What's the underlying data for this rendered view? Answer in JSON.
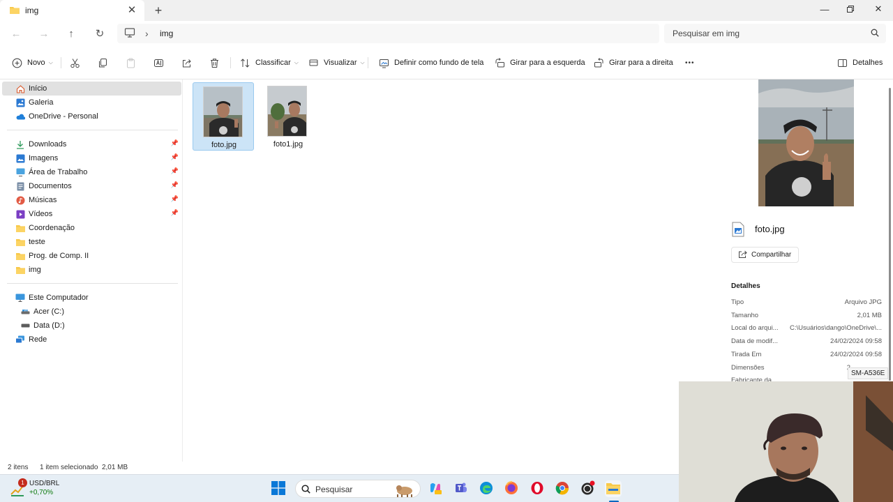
{
  "window": {
    "tab_title": "img",
    "new_tab_symbol": "+"
  },
  "address": {
    "crumb": "img",
    "search_placeholder": "Pesquisar em img"
  },
  "toolbar": {
    "new_label": "Novo",
    "sort_label": "Classificar",
    "view_label": "Visualizar",
    "wallpaper_label": "Definir como fundo de tela",
    "rotate_left_label": "Girar para a esquerda",
    "rotate_right_label": "Girar para a direita",
    "more_symbol": "•••",
    "details_label": "Detalhes"
  },
  "sidebar": {
    "top": [
      {
        "label": "Início",
        "icon": "home-icon"
      },
      {
        "label": "Galeria",
        "icon": "gallery-icon"
      },
      {
        "label": "OneDrive - Personal",
        "icon": "onedrive-icon"
      }
    ],
    "quick": [
      {
        "label": "Downloads",
        "icon": "download-icon"
      },
      {
        "label": "Imagens",
        "icon": "pictures-icon"
      },
      {
        "label": "Área de Trabalho",
        "icon": "desktop-icon"
      },
      {
        "label": "Documentos",
        "icon": "documents-icon"
      },
      {
        "label": "Músicas",
        "icon": "music-icon"
      },
      {
        "label": "Vídeos",
        "icon": "videos-icon"
      },
      {
        "label": "Coordenação",
        "icon": "folder-icon"
      },
      {
        "label": "teste",
        "icon": "folder-icon"
      },
      {
        "label": "Prog. de Comp. II",
        "icon": "folder-icon"
      },
      {
        "label": "img",
        "icon": "folder-icon"
      }
    ],
    "devices": [
      {
        "label": "Este Computador",
        "icon": "computer-icon"
      },
      {
        "label": "Acer (C:)",
        "icon": "drive-icon"
      },
      {
        "label": "Data (D:)",
        "icon": "drive-icon"
      },
      {
        "label": "Rede",
        "icon": "network-icon"
      }
    ]
  },
  "files": [
    {
      "name": "foto.jpg",
      "selected": true
    },
    {
      "name": "foto1.jpg",
      "selected": false
    }
  ],
  "details": {
    "file_name": "foto.jpg",
    "share_label": "Compartilhar",
    "section_title": "Detalhes",
    "rows": [
      {
        "key": "Tipo",
        "value": "Arquivo JPG"
      },
      {
        "key": "Tamanho",
        "value": "2,01 MB"
      },
      {
        "key": "Local do arqui...",
        "value": "C:\\Usuários\\dango\\OneDrive\\..."
      },
      {
        "key": "Data de modif...",
        "value": "24/02/2024 09:58"
      },
      {
        "key": "Tirada Em",
        "value": "24/02/2024 09:58"
      },
      {
        "key": "Dimensões",
        "value": "2"
      },
      {
        "key": "Fabricante da...",
        "value": ""
      }
    ],
    "tooltip": "SM-A536E"
  },
  "status": {
    "count": "2 itens",
    "selection": "1 item selecionado  2,01 MB"
  },
  "taskbar": {
    "widget_badge": "1",
    "widget_title": "USD/BRL",
    "widget_value": "+0,70%",
    "search_label": "Pesquisar"
  },
  "colors": {
    "accent": "#0067c0",
    "folder": "#f8c94a",
    "selection": "#cce4f7",
    "widget_value": "#0f7b0f"
  }
}
